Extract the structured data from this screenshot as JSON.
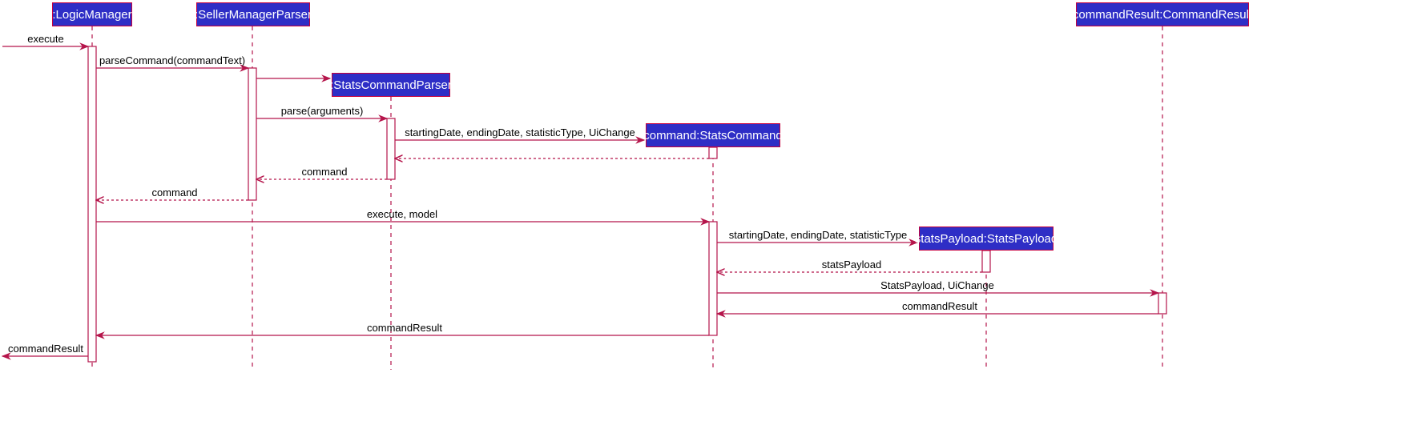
{
  "colors": {
    "participant_fill": "#2e2ec6",
    "participant_border": "#c8003c",
    "participant_text": "#ffffff",
    "line": "#b5154b",
    "activation_fill": "#ffffff",
    "label_text": "#000000"
  },
  "participants": [
    {
      "id": "logic-manager",
      "label": ":LogicManager"
    },
    {
      "id": "seller-manager-parser",
      "label": ":SellerManagerParser"
    },
    {
      "id": "stats-command-parser",
      "label": ":StatsCommandParser"
    },
    {
      "id": "stats-command",
      "label": "command:StatsCommand"
    },
    {
      "id": "stats-payload",
      "label": "statsPayload:StatsPayload"
    },
    {
      "id": "command-result",
      "label": "commandResult:CommandResult"
    }
  ],
  "messages": [
    {
      "id": "execute-in",
      "label": "execute",
      "kind": "call"
    },
    {
      "id": "parse-command",
      "label": "parseCommand(commandText)",
      "kind": "call"
    },
    {
      "id": "create-parser",
      "label": "",
      "kind": "create"
    },
    {
      "id": "parse-arguments",
      "label": "parse(arguments)",
      "kind": "call"
    },
    {
      "id": "create-stats-command",
      "label": "startingDate, endingDate, statisticType, UiChange",
      "kind": "create"
    },
    {
      "id": "stats-command-return",
      "label": "",
      "kind": "return"
    },
    {
      "id": "command-return-1",
      "label": "command",
      "kind": "return"
    },
    {
      "id": "command-return-2",
      "label": "command",
      "kind": "return"
    },
    {
      "id": "execute-model",
      "label": "execute, model",
      "kind": "call"
    },
    {
      "id": "create-stats-payload",
      "label": "startingDate, endingDate, statisticType",
      "kind": "create"
    },
    {
      "id": "stats-payload-return",
      "label": "statsPayload",
      "kind": "return"
    },
    {
      "id": "create-command-result",
      "label": "StatsPayload, UiChange",
      "kind": "create"
    },
    {
      "id": "command-result-return",
      "label": "commandResult",
      "kind": "reply"
    },
    {
      "id": "command-result-return-2",
      "label": "commandResult",
      "kind": "reply"
    },
    {
      "id": "command-result-out",
      "label": "commandResult",
      "kind": "reply"
    }
  ]
}
